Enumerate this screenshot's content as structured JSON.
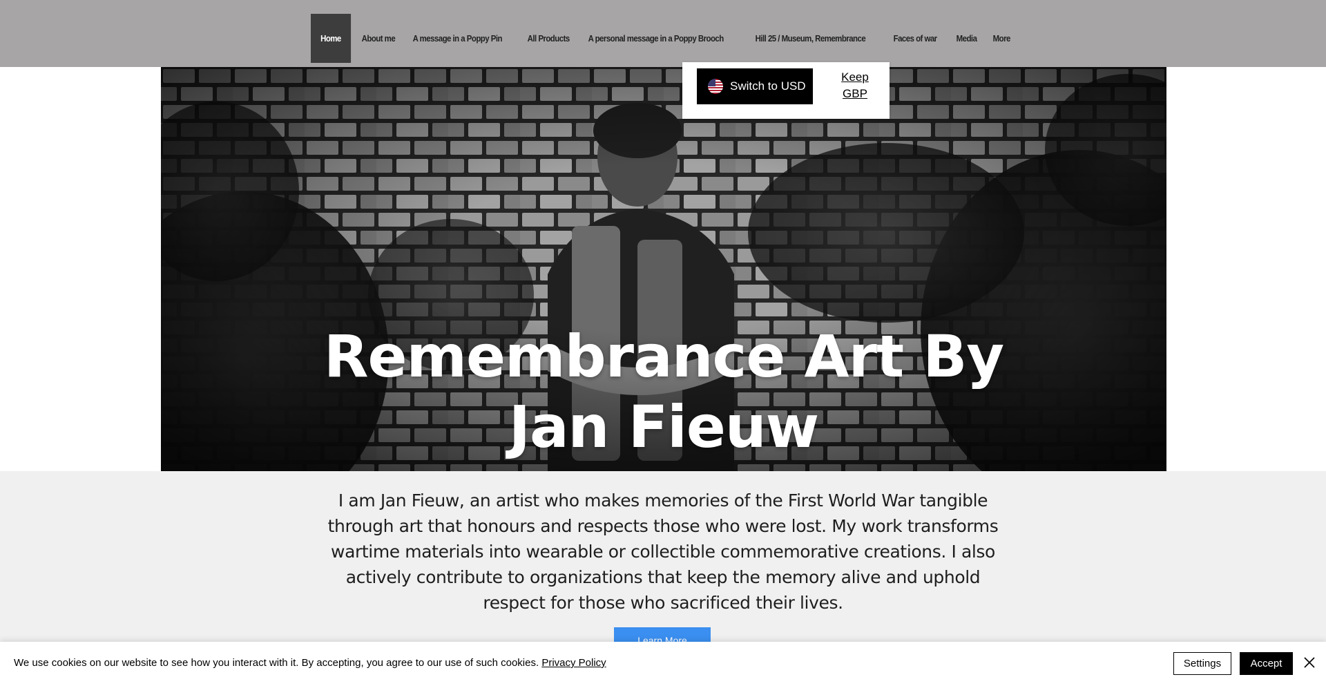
{
  "nav": {
    "items": [
      {
        "label": "Home",
        "active": true
      },
      {
        "label": "About me"
      },
      {
        "label": "A message in a Poppy Pin"
      },
      {
        "label": "All Products"
      },
      {
        "label": "A personal message in a Poppy Brooch"
      },
      {
        "label": "Hill 25 / Museum, Remembrance"
      },
      {
        "label": "Faces of war"
      },
      {
        "label": "Media"
      },
      {
        "label": "More"
      }
    ]
  },
  "currency": {
    "switch_label": "Switch to USD",
    "keep_label": "Keep GBP",
    "flag_icon": "us-flag-icon"
  },
  "hero": {
    "title_line1": "Remembrance Art By",
    "title_line2": "Jan Fieuw"
  },
  "about": {
    "text": "I am Jan Fieuw, an artist who makes memories of the First World War tangible through art that honours and respects those who were lost. My work transforms wartime materials into wearable or collectible commemorative creations. I also actively contribute to organizations that keep the memory alive and uphold respect for those who sacrificed their lives.",
    "button_label": "Learn More"
  },
  "cookie": {
    "text": "We use cookies on our website to see how you interact with it. By accepting, you agree to our use of such cookies.",
    "policy_label": "Privacy Policy",
    "settings_label": "Settings",
    "accept_label": "Accept",
    "close_icon": "close-icon"
  },
  "colors": {
    "header_bg": "#a7a5a6",
    "nav_active": "#3d3d3d",
    "button_blue": "#3b8ff0",
    "page_bg": "#f0f0f0"
  }
}
